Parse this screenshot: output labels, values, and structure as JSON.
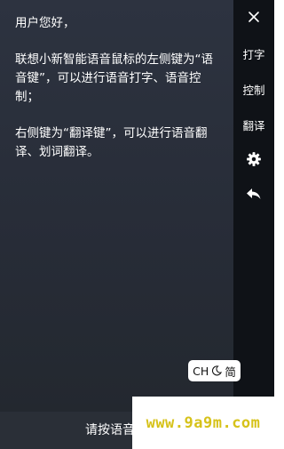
{
  "message": {
    "lines": [
      "用户您好，",
      "",
      "联想小新智能语音鼠标的左侧键为“语音键”，可以进行语音打字、语音控制；",
      "",
      "右侧键为“翻译键”，可以进行语音翻译、划词翻译。"
    ]
  },
  "sidebar": {
    "close_icon": "close-icon",
    "type_label": "打字",
    "control_label": "控制",
    "translate_label": "翻译",
    "settings_icon": "gear-icon",
    "back_icon": "back-arrow-icon"
  },
  "lang_badge": {
    "lang": "CH",
    "mode_icon": "crescent-icon",
    "script": "简"
  },
  "bottom": {
    "prompt": "请按语音"
  },
  "watermark": {
    "text": "www.9a9m.com"
  },
  "colors": {
    "panel": "#2b303c",
    "sidebar": "#0f1217",
    "watermark": "#d6c21a"
  }
}
